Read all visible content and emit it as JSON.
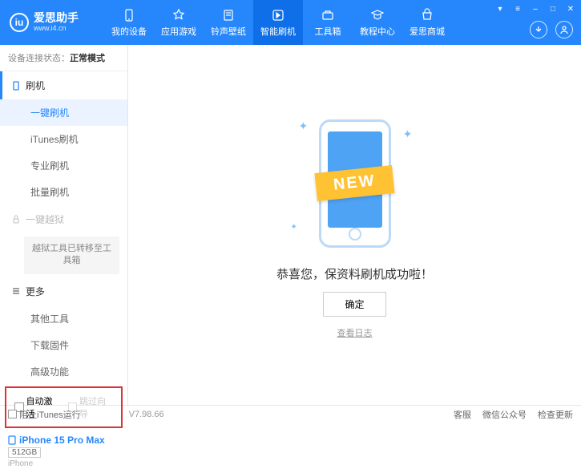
{
  "header": {
    "logo_title": "爱思助手",
    "logo_url": "www.i4.cn",
    "nav": [
      {
        "label": "我的设备"
      },
      {
        "label": "应用游戏"
      },
      {
        "label": "铃声壁纸"
      },
      {
        "label": "智能刷机"
      },
      {
        "label": "工具箱"
      },
      {
        "label": "教程中心"
      },
      {
        "label": "爱思商城"
      }
    ]
  },
  "sidebar": {
    "conn_label": "设备连接状态：",
    "conn_mode": "正常模式",
    "sections": {
      "flash": {
        "title": "刷机",
        "items": [
          "一键刷机",
          "iTunes刷机",
          "专业刷机",
          "批量刷机"
        ]
      },
      "jailbreak": {
        "title": "一键越狱",
        "note": "越狱工具已转移至工具箱"
      },
      "more": {
        "title": "更多",
        "items": [
          "其他工具",
          "下载固件",
          "高级功能"
        ]
      }
    },
    "checkboxes": {
      "auto_activate": "自动激活",
      "skip_guide": "跳过向导"
    },
    "device": {
      "name": "iPhone 15 Pro Max",
      "storage": "512GB",
      "type": "iPhone"
    }
  },
  "main": {
    "ribbon": "NEW",
    "success_text": "恭喜您，保资料刷机成功啦！",
    "confirm": "确定",
    "view_log": "查看日志"
  },
  "footer": {
    "block_itunes": "阻止iTunes运行",
    "version": "V7.98.66",
    "items": [
      "客服",
      "微信公众号",
      "检查更新"
    ]
  }
}
